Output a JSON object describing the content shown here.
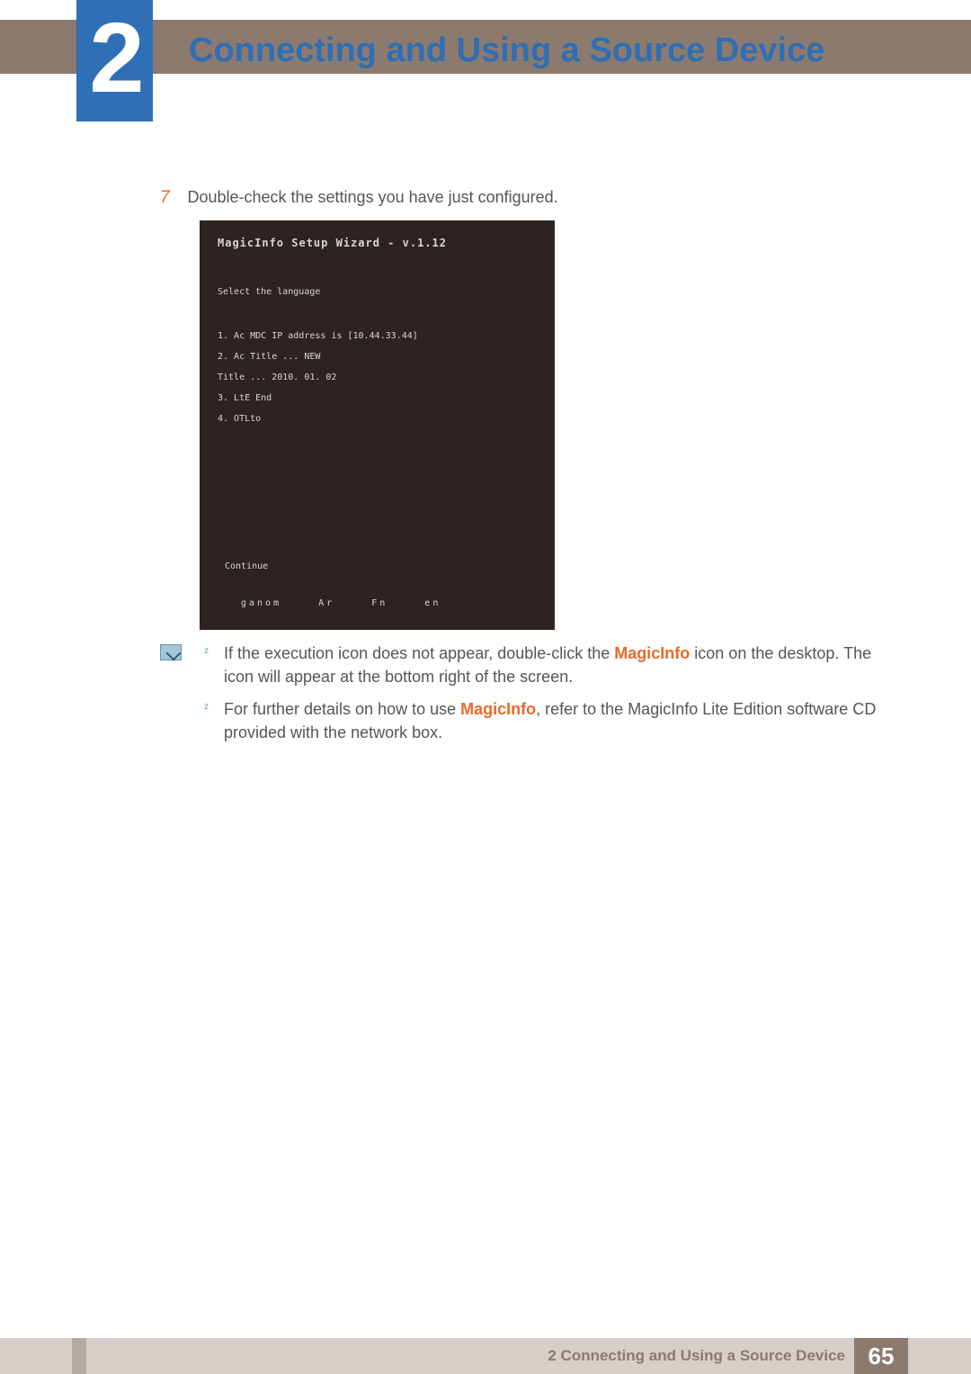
{
  "header": {
    "chapter_number": "2",
    "chapter_title": "Connecting and Using a Source Device"
  },
  "step": {
    "number": "7",
    "text": "Double-check the settings you have just configured."
  },
  "screenshot": {
    "title": "MagicInfo Setup Wizard - v.1.12",
    "subtitle": "Select the language",
    "lines": [
      "1. Ac MDC IP address is [10.44.33.44]",
      "2. Ac Title ... NEW",
      "    Title ... 2010. 01. 02",
      "3. LtE End",
      "4. OTLto"
    ],
    "footer_label": "Continue",
    "footer_keys": [
      "ganom",
      "Ar",
      "Fn",
      "en"
    ]
  },
  "notes": {
    "item1_pre": "If the execution icon does not appear, double-click the ",
    "item1_hl": "MagicInfo",
    "item1_post": " icon on the desktop. The icon will appear at the bottom right of the screen.",
    "item2_pre": "For further details on how to use ",
    "item2_hl": "MagicInfo",
    "item2_post": ", refer to the MagicInfo Lite Edition software CD provided with the network box."
  },
  "footer": {
    "label": "2 Connecting and Using a Source Device",
    "page_number": "65"
  }
}
